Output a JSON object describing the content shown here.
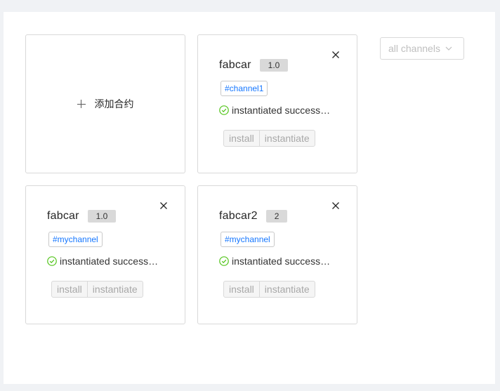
{
  "add_card": {
    "label": "添加合约"
  },
  "channel_filter": {
    "selected": "all channels"
  },
  "chaincodes": [
    {
      "name": "fabcar",
      "version": "1.0",
      "channel": "#channel1",
      "status": "instantiated success…",
      "install_label": "install",
      "instantiate_label": "instantiate"
    },
    {
      "name": "fabcar",
      "version": "1.0",
      "channel": "#mychannel",
      "status": "instantiated success…",
      "install_label": "install",
      "instantiate_label": "instantiate"
    },
    {
      "name": "fabcar2",
      "version": "2",
      "channel": "#mychannel",
      "status": "instantiated success…",
      "install_label": "install",
      "instantiate_label": "instantiate"
    }
  ],
  "colors": {
    "accent": "#1677ff",
    "success": "#52c41a",
    "badge_bg": "#d9d9d9",
    "background": "#f0f2f5"
  },
  "icons": {
    "add": "plus-icon",
    "close": "close-icon",
    "status": "check-circle-icon",
    "dropdown": "chevron-down-icon"
  }
}
